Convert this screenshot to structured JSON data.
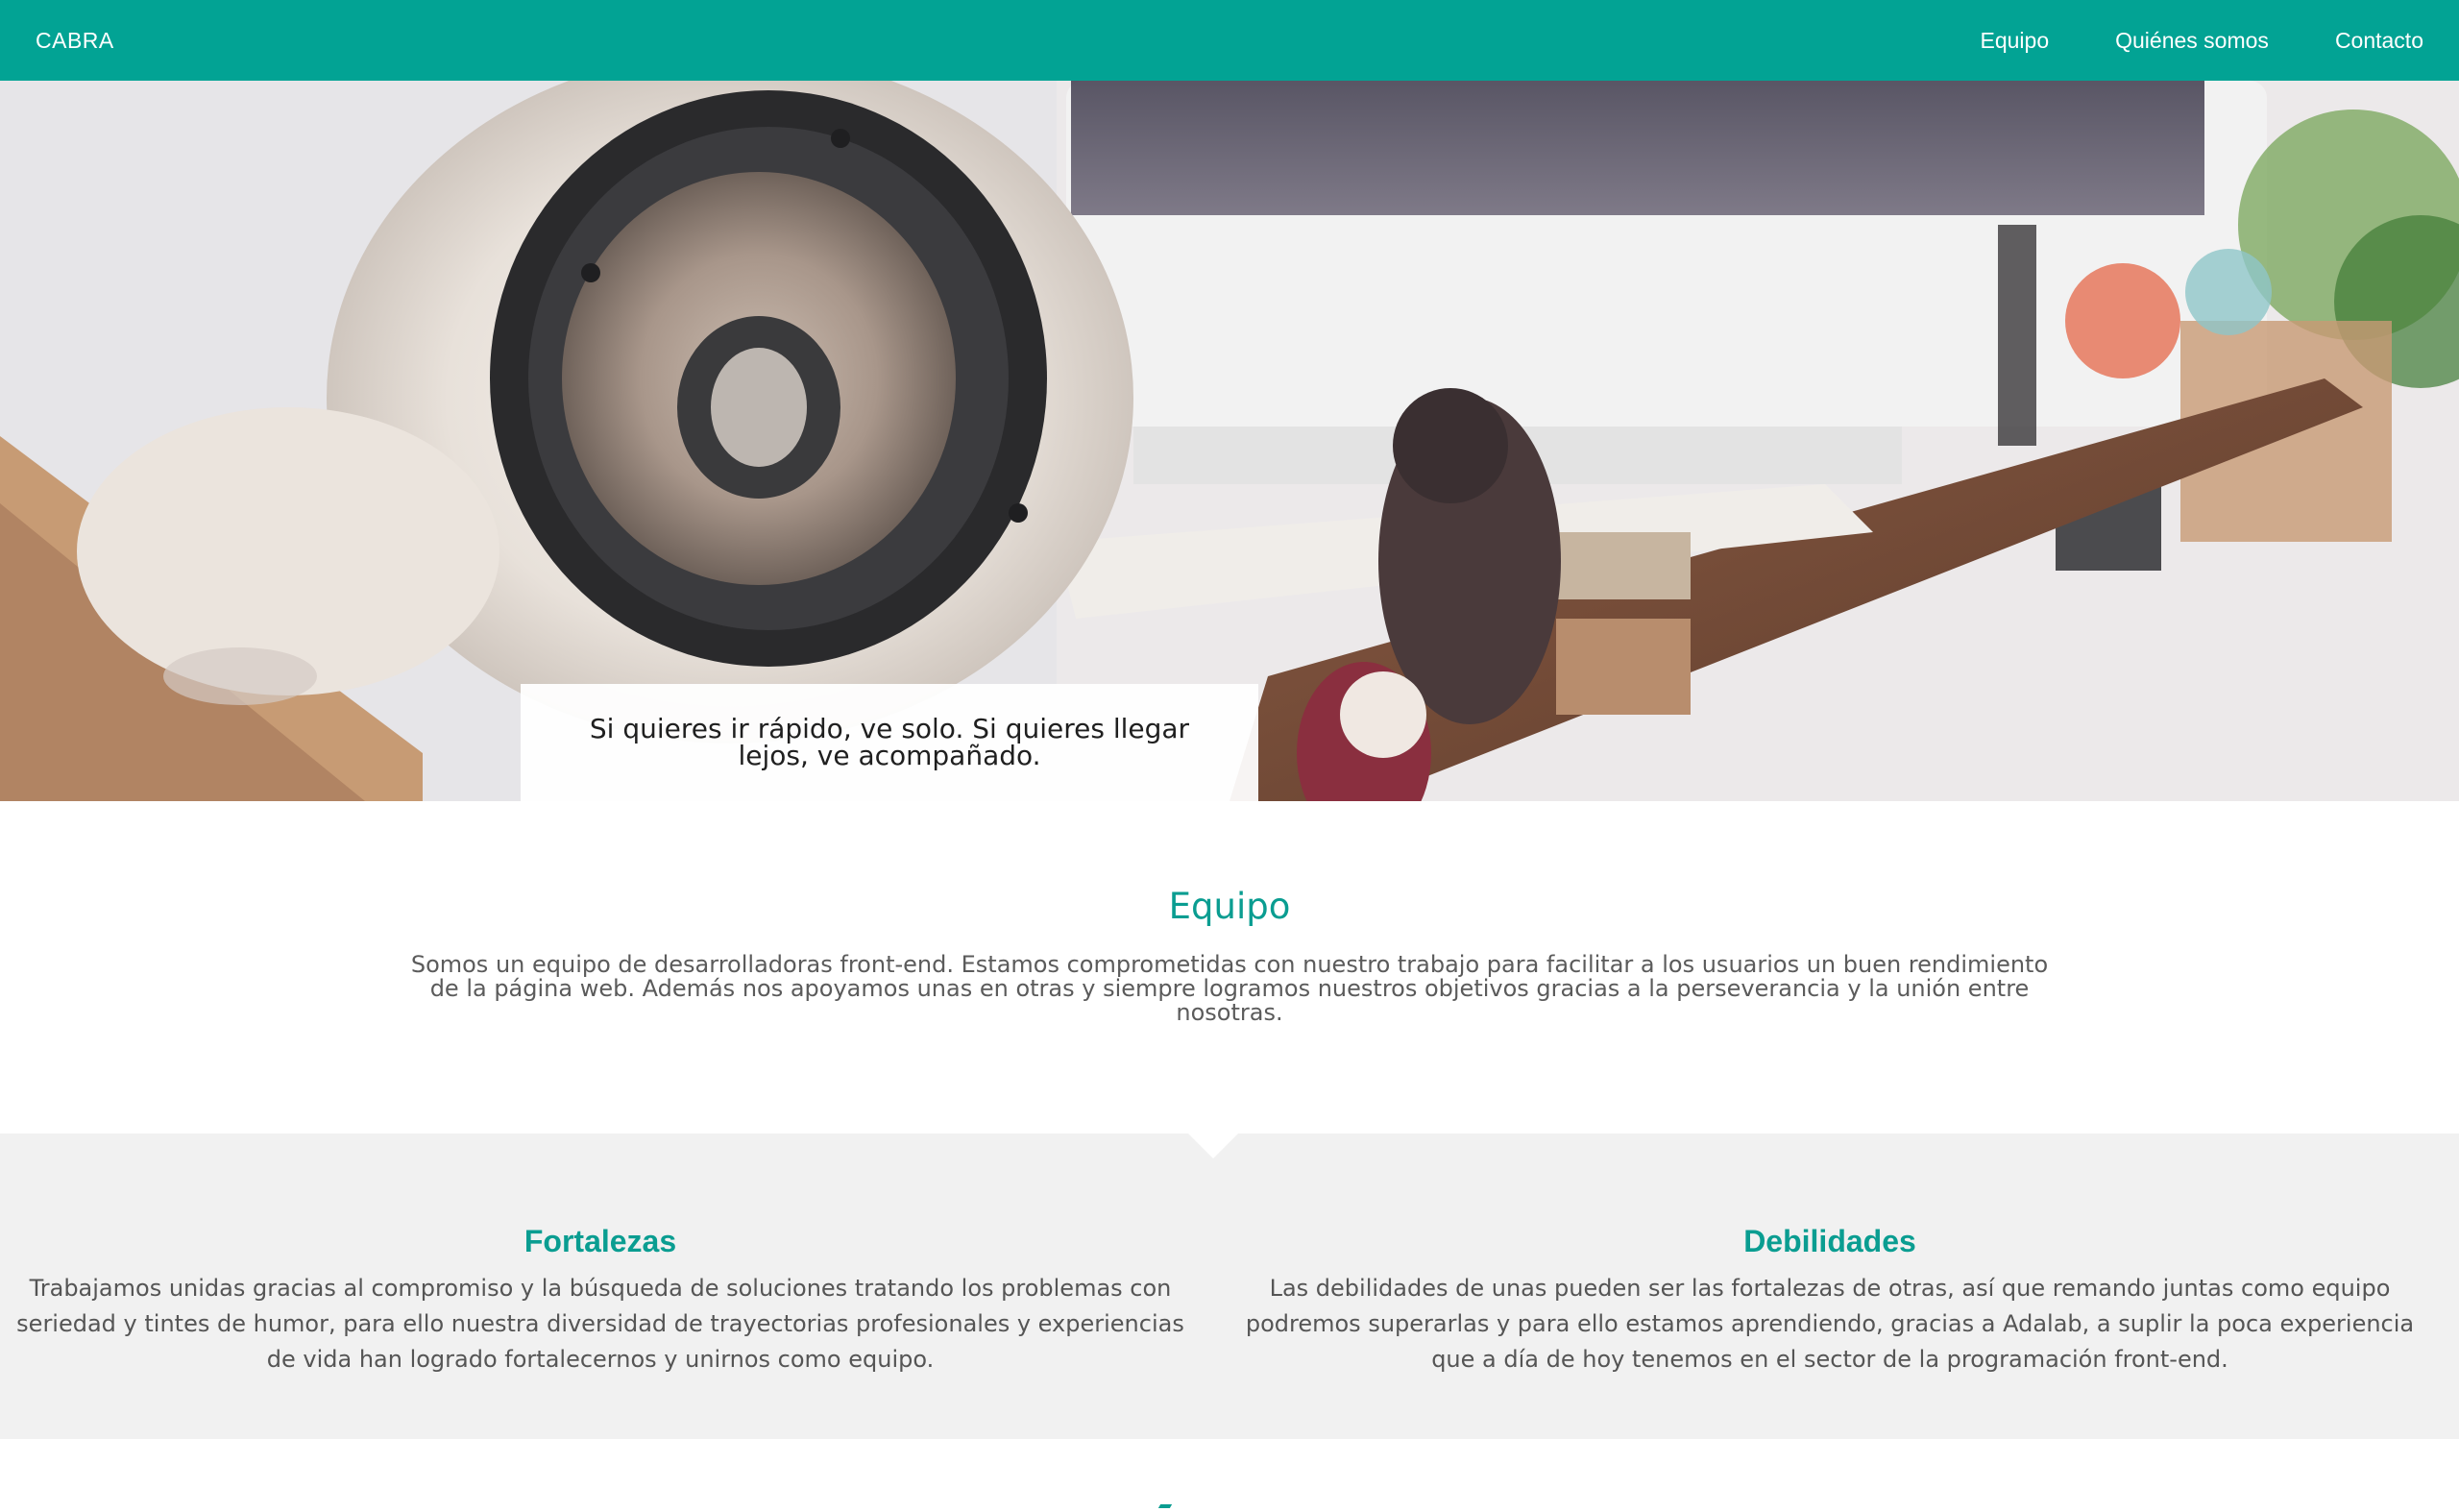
{
  "header": {
    "brand": "CABRA",
    "nav": [
      {
        "label": "Equipo"
      },
      {
        "label": "Quiénes somos"
      },
      {
        "label": "Contacto"
      }
    ]
  },
  "hero": {
    "quote": "Si quieres ir rápido, ve solo. Si quieres llegar lejos, ve acompañado."
  },
  "equipo": {
    "title": "Equipo",
    "text": "Somos un equipo de desarrolladoras front-end. Estamos comprometidas con nuestro trabajo para facilitar a los usuarios un buen rendimiento de la página web. Además nos apoyamos unas en otras y siempre logramos nuestros objetivos gracias a la perseverancia y la unión entre nosotras."
  },
  "strengths": {
    "title": "Fortalezas",
    "text": "Trabajamos unidas gracias al compromiso y la búsqueda de soluciones tratando los problemas con seriedad y tintes de humor, para ello nuestra diversidad de trayectorias profesionales y experiencias de vida han logrado fortalecernos y unirnos como equipo."
  },
  "weaknesses": {
    "title": "Debilidades",
    "text": "Las debilidades de unas pueden ser las fortalezas de otras, así que remando juntas como equipo podremos superarlas y para ello estamos aprendiendo, gracias a Adalab, a suplir la poca experiencia que a día de hoy tenemos en el sector de la programación front-end."
  },
  "colors": {
    "brand": "#02a394",
    "heading": "#0a9d91",
    "section_bg": "#f1f1f1"
  }
}
